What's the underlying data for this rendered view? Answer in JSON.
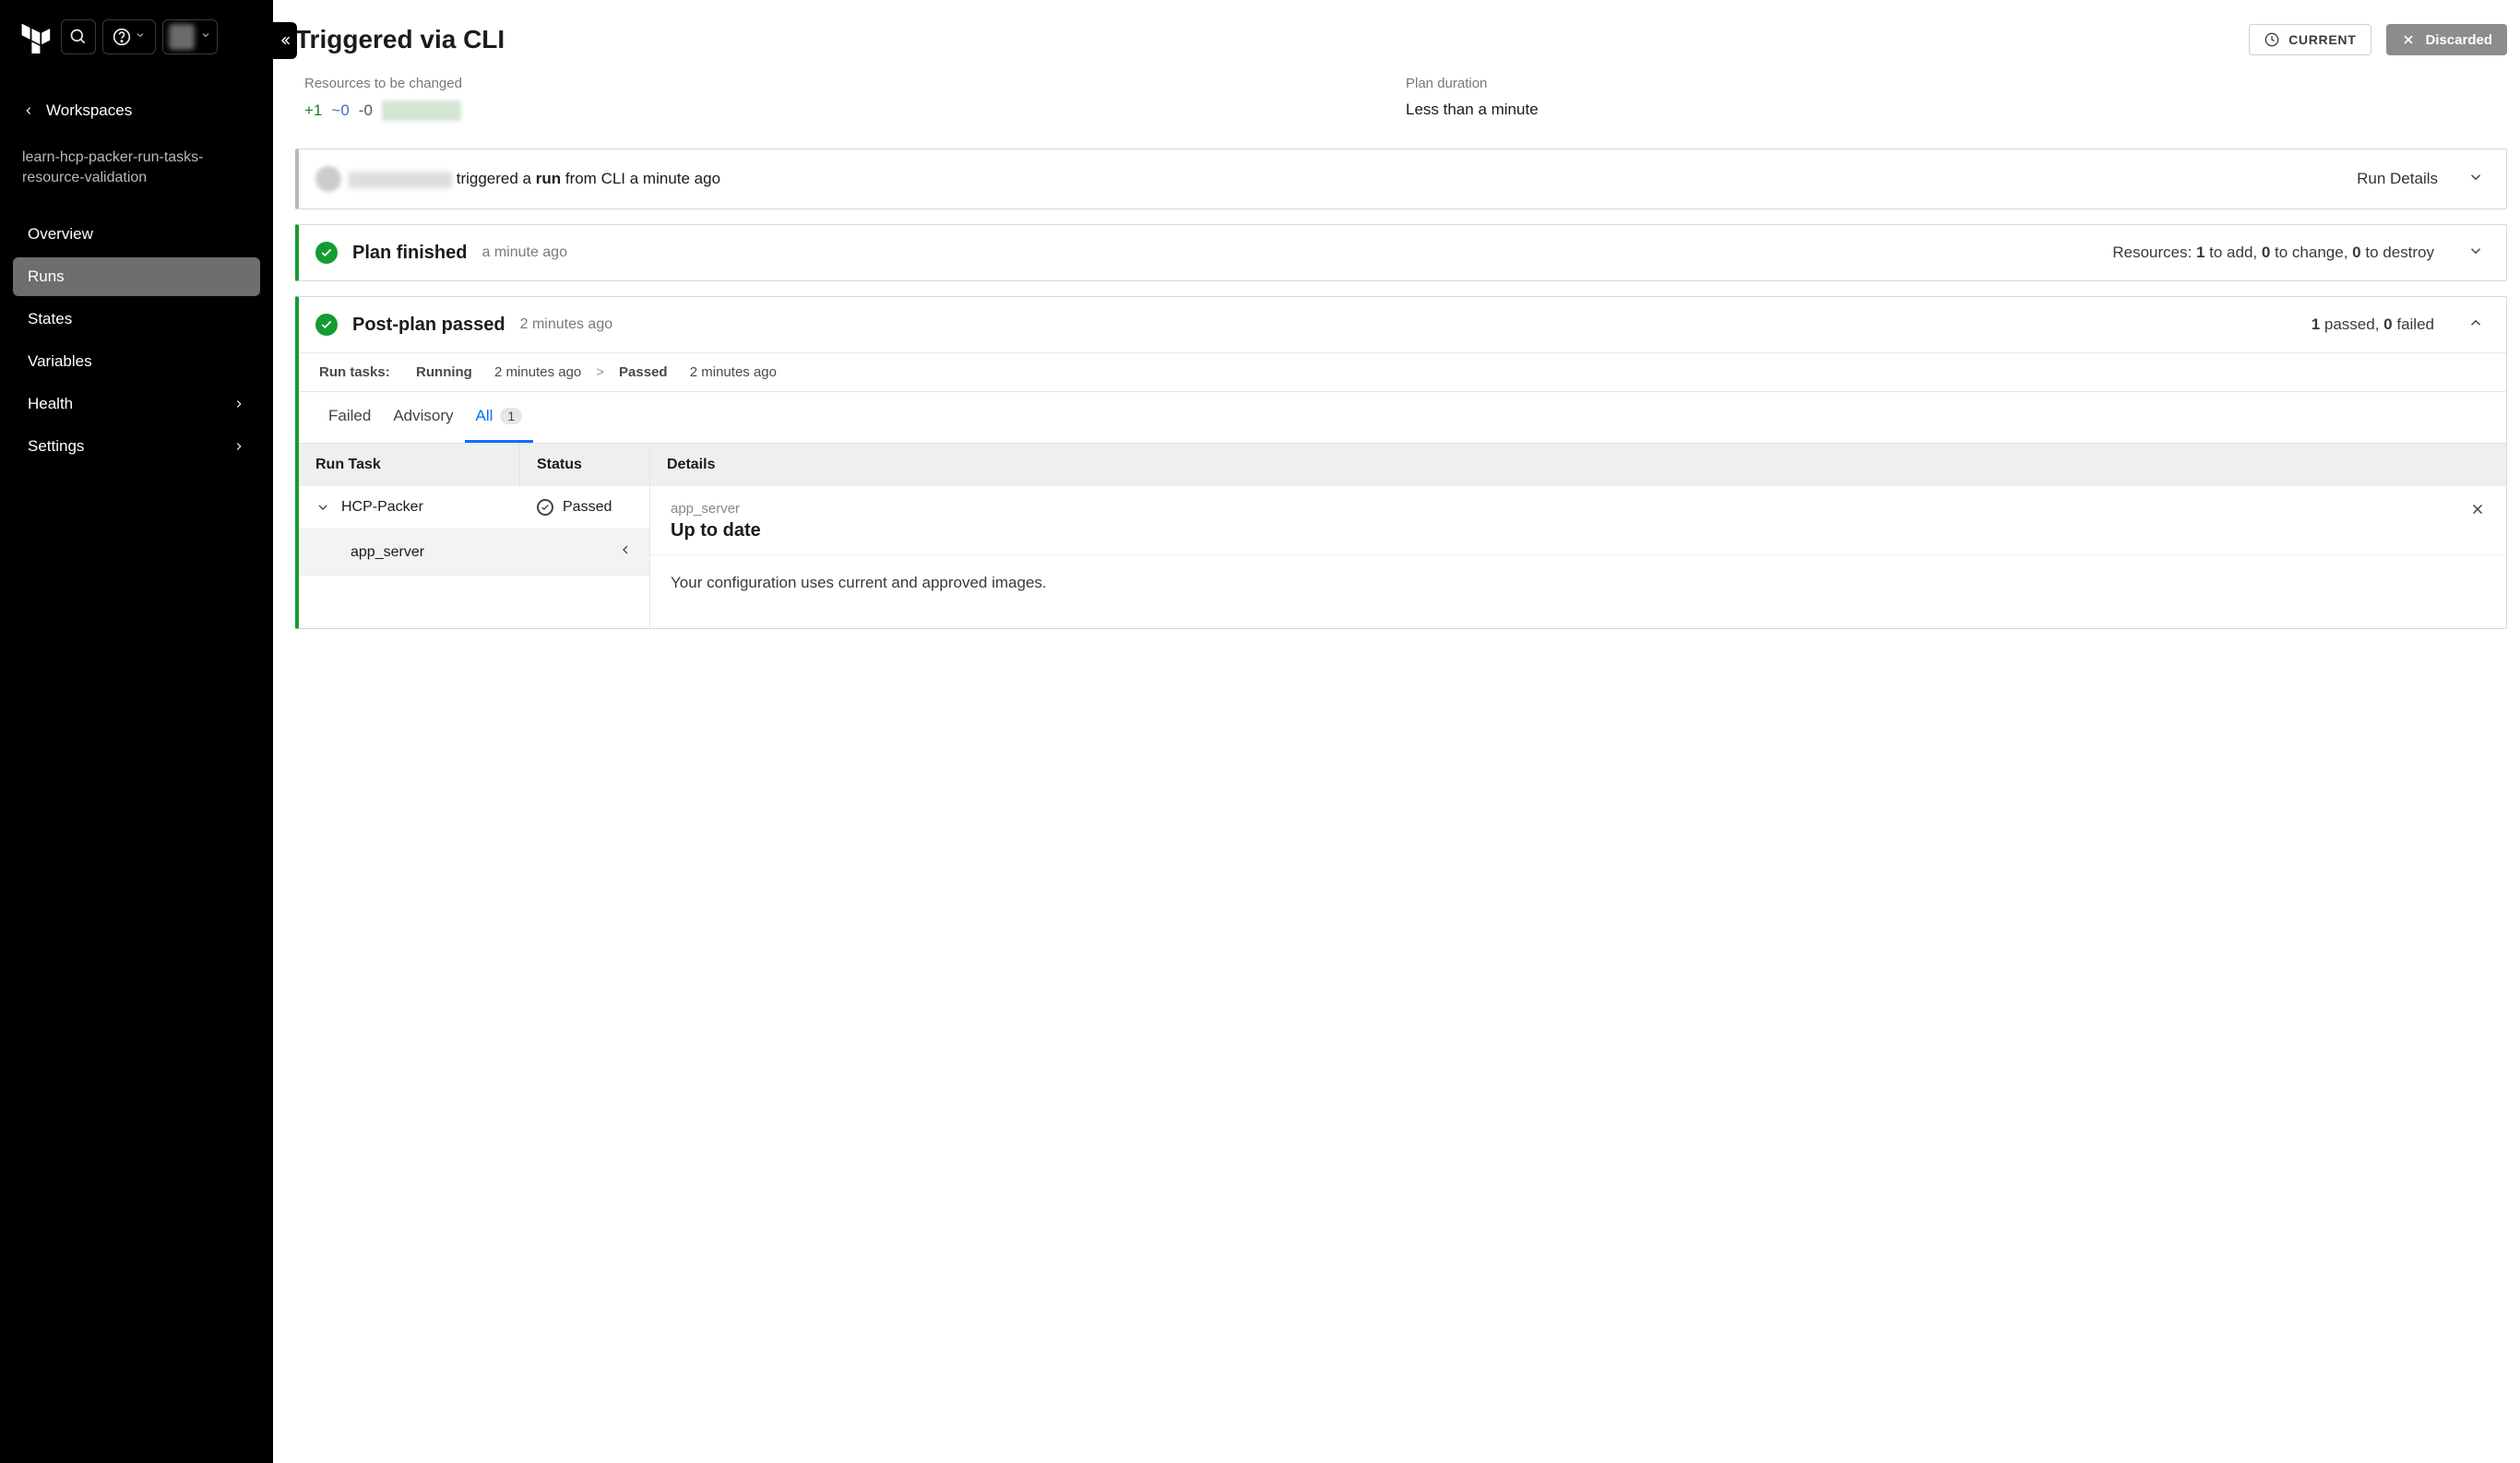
{
  "sidebar": {
    "workspaces_label": "Workspaces",
    "workspace_name": "learn-hcp-packer-run-tasks-resource-validation",
    "nav": {
      "overview": "Overview",
      "runs": "Runs",
      "states": "States",
      "variables": "Variables",
      "health": "Health",
      "settings": "Settings"
    }
  },
  "header": {
    "title": "Triggered via CLI",
    "current_label": "CURRENT",
    "discarded_label": "Discarded"
  },
  "summary": {
    "resources_label": "Resources to be changed",
    "add": "+1",
    "change": "~0",
    "destroy": "-0",
    "plan_duration_label": "Plan duration",
    "plan_duration_value": "Less than a minute"
  },
  "triggered": {
    "prefix": " triggered a ",
    "bold": "run",
    "suffix": " from CLI a minute ago",
    "details_label": "Run Details"
  },
  "plan": {
    "title": "Plan finished",
    "time": "a minute ago",
    "res_prefix": "Resources: ",
    "res_add_n": "1",
    "res_add_t": " to add, ",
    "res_chg_n": "0",
    "res_chg_t": " to change, ",
    "res_des_n": "0",
    "res_des_t": " to destroy"
  },
  "postplan": {
    "title": "Post-plan passed",
    "time": "2 minutes ago",
    "passed_n": "1",
    "passed_t": " passed, ",
    "failed_n": "0",
    "failed_t": " failed",
    "tasks_label": "Run tasks:",
    "running_label": "Running",
    "running_time": "2 minutes ago",
    "passed_label": "Passed",
    "passed_time": "2 minutes ago",
    "tabs": {
      "failed": "Failed",
      "advisory": "Advisory",
      "all": "All",
      "all_count": "1"
    },
    "table": {
      "th_task": "Run Task",
      "th_status": "Status",
      "th_details": "Details",
      "task_name": "HCP-Packer",
      "task_status": "Passed",
      "subtask": "app_server"
    },
    "details": {
      "sublabel": "app_server",
      "headline": "Up to date",
      "body": "Your configuration uses current and approved images."
    }
  }
}
